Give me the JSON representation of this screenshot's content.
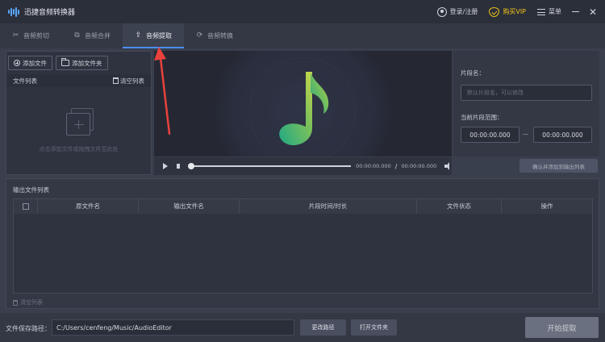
{
  "app": {
    "title": "迅捷音频转换器",
    "login": "登录/注册",
    "vip": "购买VIP",
    "menu": "菜单"
  },
  "tabs": [
    {
      "label": "音频剪切",
      "icon": "scissors-icon"
    },
    {
      "label": "音频合并",
      "icon": "merge-icon"
    },
    {
      "label": "音频提取",
      "icon": "extract-icon",
      "active": true
    },
    {
      "label": "音频转换",
      "icon": "refresh-icon"
    }
  ],
  "file_panel": {
    "add_file": "添加文件",
    "add_folder": "添加文件夹",
    "list_title": "文件列表",
    "clear_list": "清空列表",
    "empty_hint": "点击添加文件或拖拽文件至此处"
  },
  "player": {
    "current_time": "00:00:00.000",
    "separator": "/",
    "total_time": "00:00:00.000",
    "progress": 0,
    "confirm_button": "确认并添加到输出列表"
  },
  "segment": {
    "name_label": "片段名：",
    "name_placeholder": "默认片段名，可以修改",
    "range_label": "当前片段范围：",
    "start": "00:00:00.000",
    "end": "00:00:00.000"
  },
  "output": {
    "title": "输出文件列表",
    "columns": [
      "原文件名",
      "输出文件名",
      "片段时间/时长",
      "文件状态",
      "操作"
    ],
    "clear_list": "清空列表"
  },
  "footer": {
    "save_path_label": "文件保存路径：",
    "save_path": "C:/Users/cenfeng/Music/AudioEditor",
    "change_path": "更改路径",
    "open_folder": "打开文件夹",
    "start": "开始提取"
  },
  "colors": {
    "accent": "#4a8df8",
    "vip": "#f0c419",
    "annotation_arrow": "#e8423b"
  }
}
